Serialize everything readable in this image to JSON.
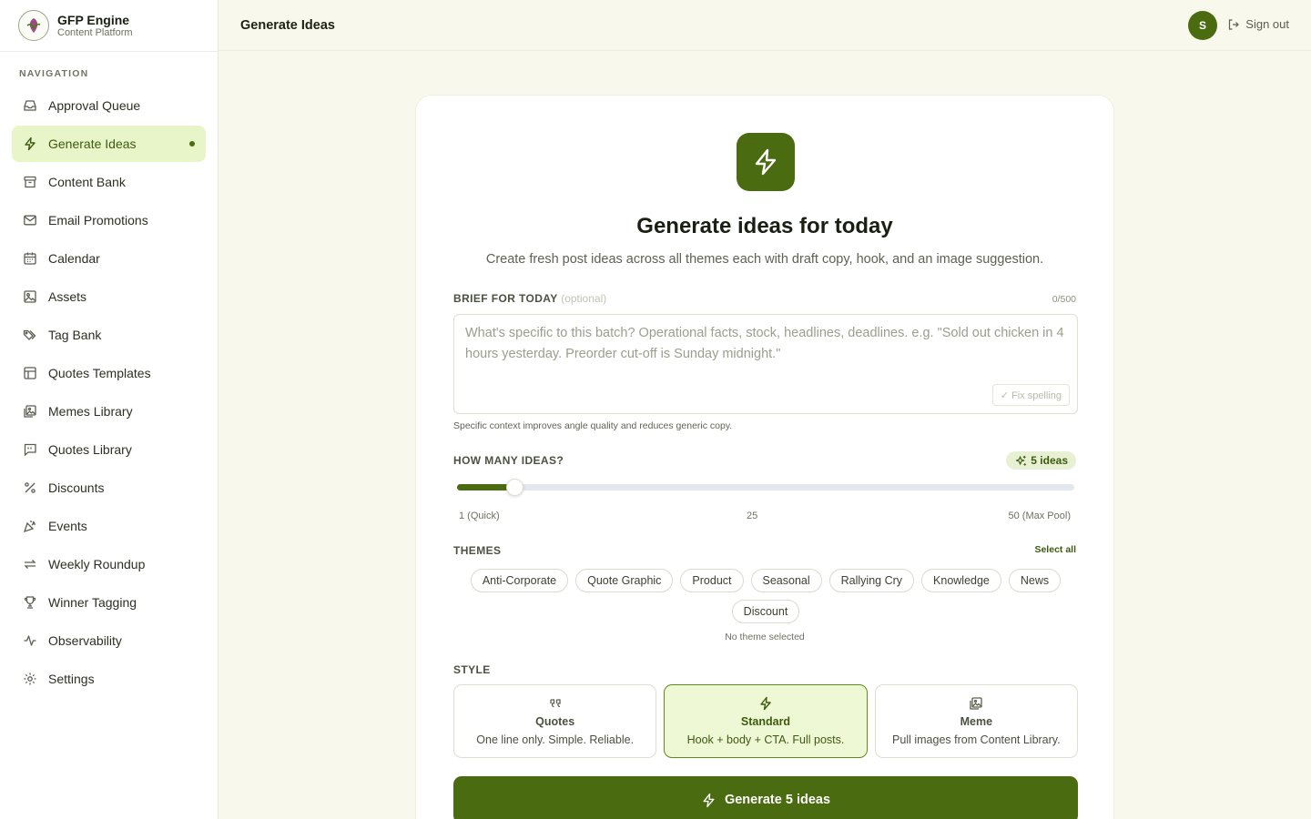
{
  "brand": {
    "name": "GFP Engine",
    "subtitle": "Content Platform"
  },
  "sidebar": {
    "heading": "NAVIGATION",
    "items": [
      {
        "label": "Approval Queue",
        "icon": "inbox-icon"
      },
      {
        "label": "Generate Ideas",
        "icon": "lightning-icon",
        "active": true
      },
      {
        "label": "Content Bank",
        "icon": "archive-icon"
      },
      {
        "label": "Email Promotions",
        "icon": "mail-icon"
      },
      {
        "label": "Calendar",
        "icon": "calendar-icon"
      },
      {
        "label": "Assets",
        "icon": "image-icon"
      },
      {
        "label": "Tag Bank",
        "icon": "tags-icon"
      },
      {
        "label": "Quotes Templates",
        "icon": "layout-icon"
      },
      {
        "label": "Memes Library",
        "icon": "images-icon"
      },
      {
        "label": "Quotes Library",
        "icon": "message-quote-icon"
      },
      {
        "label": "Discounts",
        "icon": "percent-icon"
      },
      {
        "label": "Events",
        "icon": "party-icon"
      },
      {
        "label": "Weekly Roundup",
        "icon": "repeat-icon"
      },
      {
        "label": "Winner Tagging",
        "icon": "trophy-icon"
      },
      {
        "label": "Observability",
        "icon": "activity-icon"
      },
      {
        "label": "Settings",
        "icon": "gear-icon"
      }
    ]
  },
  "header": {
    "title": "Generate Ideas",
    "avatar_initial": "S",
    "signout_label": "Sign out"
  },
  "main": {
    "title": "Generate ideas for today",
    "subtitle": "Create fresh post ideas across all themes each with draft copy, hook, and an image suggestion.",
    "brief": {
      "label": "BRIEF FOR TODAY",
      "optional": "(optional)",
      "counter": "0/500",
      "placeholder": "What's specific to this batch? Operational facts, stock, headlines, deadlines. e.g. \"Sold out chicken in 4 hours yesterday. Preorder cut-off is Sunday midnight.\"",
      "fix_label": "✓ Fix spelling",
      "hint": "Specific context improves angle quality and reduces generic copy."
    },
    "count": {
      "label": "HOW MANY IDEAS?",
      "value": 5,
      "badge": "5 ideas",
      "min": 1,
      "max": 50,
      "tick_min": "1 (Quick)",
      "tick_mid": "25",
      "tick_max": "50 (Max Pool)"
    },
    "themes": {
      "label": "THEMES",
      "select_all": "Select all",
      "chips": [
        "Anti-Corporate",
        "Quote Graphic",
        "Product",
        "Seasonal",
        "Rallying Cry",
        "Knowledge",
        "News",
        "Discount"
      ],
      "empty_note": "No theme selected"
    },
    "style": {
      "label": "STYLE",
      "options": [
        {
          "name": "Quotes",
          "desc": "One line only. Simple. Reliable.",
          "icon": "quote-icon"
        },
        {
          "name": "Standard",
          "desc": "Hook + body + CTA. Full posts.",
          "icon": "lightning-icon",
          "active": true
        },
        {
          "name": "Meme",
          "desc": "Pull images from Content Library.",
          "icon": "images-icon"
        }
      ]
    },
    "generate_label": "Generate 5 ideas"
  },
  "colors": {
    "accent": "#4a6b0f",
    "accent_light": "#e8f5c8",
    "background": "#f8f9ec"
  }
}
